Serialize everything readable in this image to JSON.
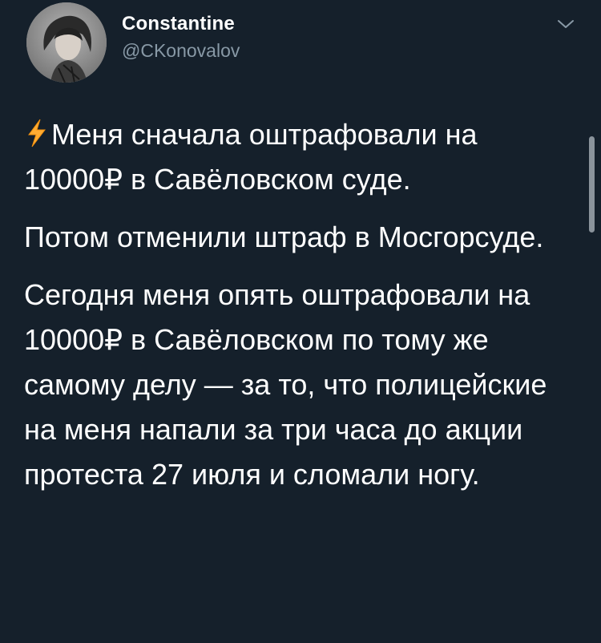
{
  "tweet": {
    "author": {
      "display_name": "Constantine",
      "handle": "@CKonovalov"
    },
    "menu_icon": "chevron-down-icon",
    "lead_emoji": "lightning-bolt",
    "paragraphs": [
      "Меня сначала оштрафовали на 10000₽ в Савёловском суде.",
      "Потом отменили штраф в Мосгорсуде.",
      "Сегодня меня опять оштрафовали на 10000₽ в Савёловском по тому же самому делу — за то, что полицейские на меня напали за три часа до акции протеста 27 июля и сломали ногу."
    ],
    "colors": {
      "background": "#15202b",
      "text": "#ffffff",
      "secondary_text": "#8899a6"
    }
  }
}
